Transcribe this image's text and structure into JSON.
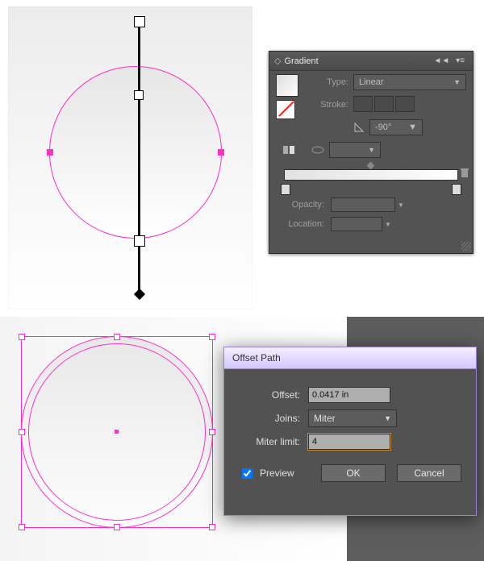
{
  "gradient_panel": {
    "title": "Gradient",
    "type_label": "Type:",
    "type_value": "Linear",
    "stroke_label": "Stroke:",
    "angle_value": "-90°",
    "opacity_label": "Opacity:",
    "location_label": "Location:"
  },
  "offset_dialog": {
    "title": "Offset Path",
    "offset_label": "Offset:",
    "offset_value": "0.0417 in",
    "joins_label": "Joins:",
    "joins_value": "Miter",
    "miter_label": "Miter limit:",
    "miter_value": "4",
    "preview_label": "Preview",
    "preview_checked": true,
    "ok_label": "OK",
    "cancel_label": "Cancel"
  }
}
